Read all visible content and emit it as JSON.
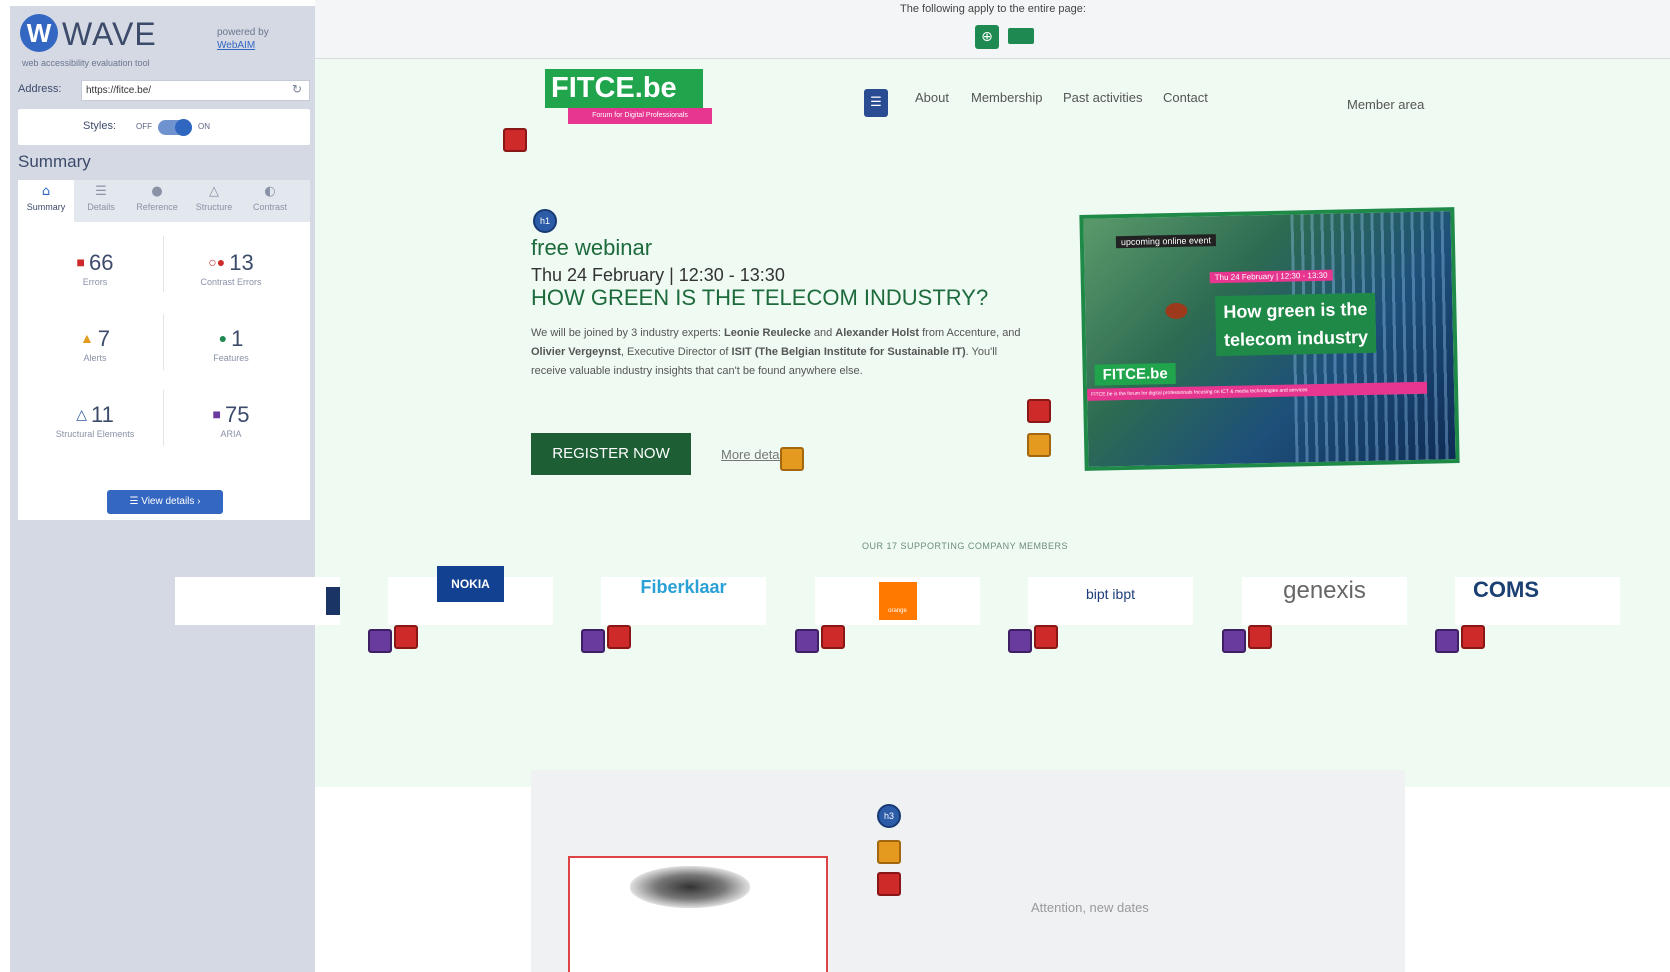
{
  "wave": {
    "logo_letter": "W",
    "name": "WAVE",
    "tagline": "web accessibility evaluation tool",
    "powered_by": "powered by",
    "powered_link": "WebAIM",
    "address_label": "Address:",
    "address_value": "https://fitce.be/",
    "styles_label": "Styles:",
    "styles_off": "OFF",
    "styles_on": "ON",
    "summary_title": "Summary",
    "tabs": [
      {
        "label": "Summary",
        "icon": "home-icon",
        "glyph": "⌂"
      },
      {
        "label": "Details",
        "icon": "list-icon",
        "glyph": "☰"
      },
      {
        "label": "Reference",
        "icon": "info-icon",
        "glyph": "●"
      },
      {
        "label": "Structure",
        "icon": "structure-icon",
        "glyph": "△"
      },
      {
        "label": "Contrast",
        "icon": "contrast-icon",
        "glyph": "◐"
      }
    ],
    "stats": {
      "errors": {
        "value": "66",
        "label": "Errors",
        "color": "#cf2a2a"
      },
      "contrast": {
        "value": "13",
        "label": "Contrast Errors",
        "color": "#cf2a2a"
      },
      "alerts": {
        "value": "7",
        "label": "Alerts",
        "color": "#e49a1e"
      },
      "features": {
        "value": "1",
        "label": "Features",
        "color": "#1e8a52"
      },
      "structural": {
        "value": "11",
        "label": "Structural Elements",
        "color": "#2c5ba8"
      },
      "aria": {
        "value": "75",
        "label": "ARIA",
        "color": "#6a3b9e"
      }
    },
    "view_details": "View details ›"
  },
  "page": {
    "top_note": "The following apply to the entire page:",
    "logo_text": "FITCE.be",
    "logo_tagline": "Forum for Digital Professionals",
    "nav": [
      "About",
      "Membership",
      "Past activities",
      "Contact"
    ],
    "member_area": "Member area",
    "h1_badge": "h1",
    "h3_badge": "h3",
    "webinar_label": "free webinar",
    "date_line": "Thu 24 February | 12:30 - 13:30",
    "headline": "HOW GREEN IS THE TELECOM INDUSTRY?",
    "desc_parts": [
      "We will be joined by 3 industry experts: ",
      "Leonie Reulecke",
      " and ",
      "Alexander Holst",
      " from Accenture, and ",
      "Olivier Vergeynst",
      ", Executive Director of ",
      "ISIT (The Belgian Institute for Sustainable IT)",
      ". You'll receive valuable industry insights that can't be found anywhere else."
    ],
    "register": "REGISTER NOW",
    "more_details": "More details",
    "banner": {
      "upcoming": "upcoming online event",
      "date": "Thu 24 February | 12:30 - 13:30",
      "title_line1": "How green is the",
      "title_line2": "telecom industry",
      "logo": "FITCE.be",
      "footer": "FITCE.be is the forum for digital professionals focusing on ICT & media technologies and services"
    },
    "members_title": "OUR 17 SUPPORTING COMPANY MEMBERS",
    "members": [
      "NOKIA",
      "Fiberklaar",
      "orange",
      "bipt ibpt",
      "genexis",
      "COMS"
    ],
    "attention": "Attention, new dates"
  }
}
